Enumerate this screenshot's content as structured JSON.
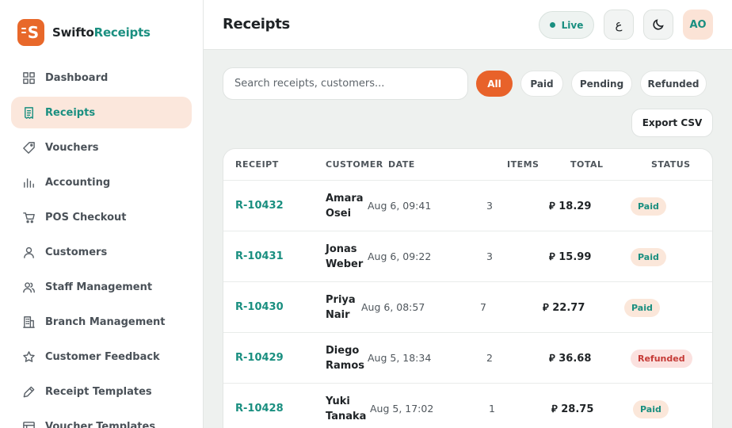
{
  "brand": {
    "name_part1": "Swifto",
    "name_part2": "Receipts",
    "logo_letter": "S"
  },
  "sidebar": {
    "items": [
      {
        "label": "Dashboard",
        "icon": "grid-icon"
      },
      {
        "label": "Receipts",
        "icon": "receipt-icon",
        "active": true
      },
      {
        "label": "Vouchers",
        "icon": "tag-icon"
      },
      {
        "label": "Accounting",
        "icon": "bar-chart-icon"
      },
      {
        "label": "POS Checkout",
        "icon": "cart-icon"
      },
      {
        "label": "Customers",
        "icon": "user-icon"
      },
      {
        "label": "Staff Management",
        "icon": "users-icon"
      },
      {
        "label": "Branch Management",
        "icon": "building-icon"
      },
      {
        "label": "Customer Feedback",
        "icon": "star-icon"
      },
      {
        "label": "Receipt Templates",
        "icon": "pen-icon"
      },
      {
        "label": "Voucher Templates",
        "icon": "template-icon"
      }
    ]
  },
  "header": {
    "title": "Receipts",
    "live_label": "Live",
    "lang_label": "ع",
    "avatar_initials": "AO"
  },
  "search": {
    "placeholder": "Search receipts, customers..."
  },
  "filters": {
    "all": "All",
    "paid": "Paid",
    "pending": "Pending",
    "refunded": "Refunded"
  },
  "export_label": "Export CSV",
  "table": {
    "columns": {
      "receipt": "RECEIPT",
      "customer": "CUSTOMER",
      "date": "DATE",
      "items": "ITEMS",
      "total": "TOTAL",
      "status": "STATUS"
    },
    "rows": [
      {
        "id": "R-10432",
        "customer": "Amara Osei",
        "date": "Aug 6, 09:41",
        "items": "3",
        "total": "⃁ 18.29",
        "status": "Paid"
      },
      {
        "id": "R-10431",
        "customer": "Jonas Weber",
        "date": "Aug 6, 09:22",
        "items": "3",
        "total": "⃁ 15.99",
        "status": "Paid"
      },
      {
        "id": "R-10430",
        "customer": "Priya Nair",
        "date": "Aug 6, 08:57",
        "items": "7",
        "total": "⃁ 22.77",
        "status": "Paid"
      },
      {
        "id": "R-10429",
        "customer": "Diego Ramos",
        "date": "Aug 5, 18:34",
        "items": "2",
        "total": "⃁ 36.68",
        "status": "Refunded"
      },
      {
        "id": "R-10428",
        "customer": "Yuki Tanaka",
        "date": "Aug 5, 17:02",
        "items": "1",
        "total": "⃁ 28.75",
        "status": "Paid"
      }
    ]
  },
  "colors": {
    "accent": "#e8622a",
    "brand_teal": "#1a8f80",
    "active_bg": "#fbe7dc"
  }
}
